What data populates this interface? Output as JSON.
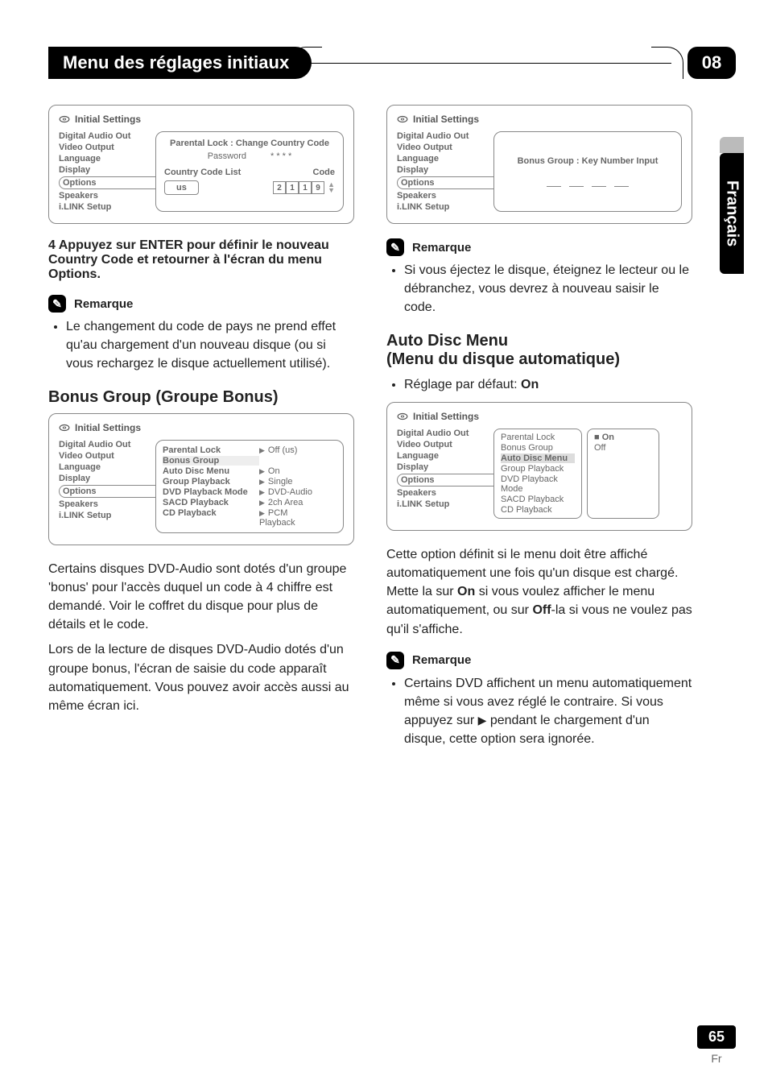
{
  "header": {
    "title": "Menu des réglages initiaux",
    "chapter": "08"
  },
  "lang_tab": "Français",
  "footer": {
    "page": "65",
    "lang": "Fr"
  },
  "common": {
    "initial_settings": "Initial Settings",
    "side_items": [
      "Digital Audio Out",
      "Video Output",
      "Language",
      "Display",
      "Options",
      "Speakers",
      "i.LINK Setup"
    ]
  },
  "box1": {
    "selected": "Options",
    "panel_title": "Parental Lock : Change Country Code",
    "password_label": "Password",
    "password_mask": "* * * *",
    "list_hdr_left": "Country Code List",
    "list_hdr_right": "Code",
    "country": "us",
    "code": [
      "2",
      "1",
      "1",
      "9"
    ]
  },
  "step4": "4   Appuyez sur ENTER pour définir le nouveau Country Code et retourner à l'écran du menu Options.",
  "note1_hdr": "Remarque",
  "note1_body": "Le  changement du code de pays ne prend effet qu'au chargement d'un nouveau disque (ou si vous rechargez le disque actuellement utilisé).",
  "bonus": {
    "heading": "Bonus Group (Groupe Bonus)",
    "options_rows": [
      {
        "k": "Parental  Lock",
        "v": "Off (us)"
      },
      {
        "k": "Bonus Group",
        "v": "",
        "sel": true
      },
      {
        "k": "Auto Disc Menu",
        "v": "On"
      },
      {
        "k": "Group Playback",
        "v": "Single"
      },
      {
        "k": "DVD Playback Mode",
        "v": "DVD-Audio"
      },
      {
        "k": "SACD Playback",
        "v": "2ch Area"
      },
      {
        "k": "CD Playback",
        "v": "PCM Playback"
      }
    ],
    "para1": "Certains disques DVD-Audio sont dotés d'un groupe 'bonus' pour l'accès duquel un code à 4 chiffre est demandé. Voir le coffret du disque pour plus de détails et le code.",
    "para2": "Lors de la lecture de disques DVD-Audio dotés d'un groupe bonus, l'écran de saisie du code apparaît automatiquement. Vous pouvez avoir accès aussi au même écran ici."
  },
  "box_key": {
    "selected": "Options",
    "panel_title": "Bonus Group : Key Number Input"
  },
  "note2_hdr": "Remarque",
  "note2_body": "Si vous éjectez le disque, éteignez le lecteur ou le débranchez, vous devrez à nouveau saisir le code.",
  "autodisc": {
    "heading1": "Auto Disc Menu",
    "heading2": "(Menu du disque automatique)",
    "default_line_pre": "Réglage par défaut: ",
    "default_value": "On",
    "options_rows": [
      {
        "k": "Parental  Lock"
      },
      {
        "k": "Bonus Group"
      },
      {
        "k": "Auto Disc Menu",
        "sel": true
      },
      {
        "k": "Group Playback"
      },
      {
        "k": "DVD Playback Mode"
      },
      {
        "k": "SACD Playback"
      },
      {
        "k": "CD Playback"
      }
    ],
    "opt_values": [
      "On",
      "Off"
    ],
    "para_pre": "Cette option définit si le menu doit être affiché automatiquement une fois qu'un disque est chargé. Mette la sur ",
    "para_mid1": "On",
    "para_mid2": " si vous voulez afficher le menu automatiquement, ou sur ",
    "para_mid3": "Off",
    "para_post": "-la si vous ne voulez pas qu'il s'affiche."
  },
  "note3_hdr": "Remarque",
  "note3_body_pre": "Certains DVD affichent un menu automatiquement même si vous avez réglé le contraire. Si vous appuyez sur ",
  "note3_body_post": " pendant le chargement d'un disque, cette option sera ignorée."
}
